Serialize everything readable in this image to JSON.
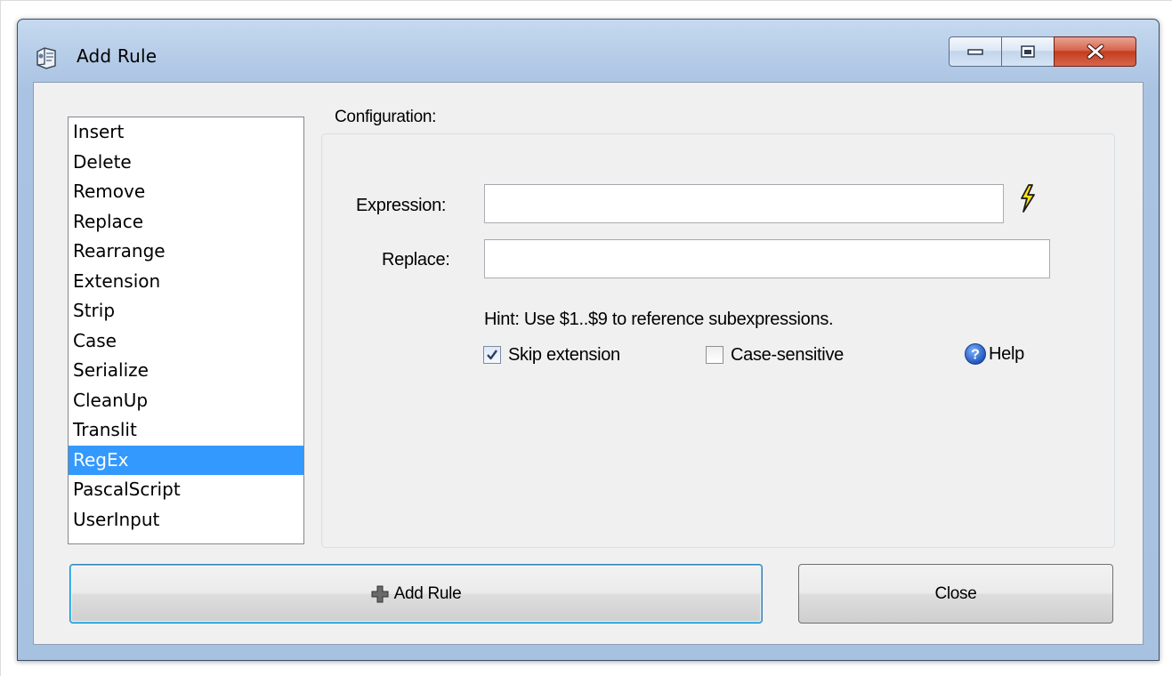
{
  "window": {
    "title": "Add Rule",
    "controls": {
      "minimize": "minimize-icon",
      "maximize": "maximize-icon",
      "close": "close-icon"
    }
  },
  "rules": {
    "items": [
      "Insert",
      "Delete",
      "Remove",
      "Replace",
      "Rearrange",
      "Extension",
      "Strip",
      "Case",
      "Serialize",
      "CleanUp",
      "Translit",
      "RegEx",
      "PascalScript",
      "UserInput"
    ],
    "selected": "RegEx"
  },
  "config": {
    "legend": "Configuration:",
    "expression_label": "Expression:",
    "expression_value": "",
    "replace_label": "Replace:",
    "replace_value": "",
    "hint": "Hint: Use $1..$9 to reference subexpressions.",
    "skip_extension": {
      "label": "Skip extension",
      "checked": true
    },
    "case_sensitive": {
      "label": "Case-sensitive",
      "checked": false
    },
    "help_label": "Help"
  },
  "buttons": {
    "add_rule": "Add Rule",
    "close": "Close"
  },
  "colors": {
    "selection": "#3399ff",
    "titlebar": "#b9cfe9",
    "close_button": "#c33d20",
    "client_bg": "#f0f0f0"
  }
}
